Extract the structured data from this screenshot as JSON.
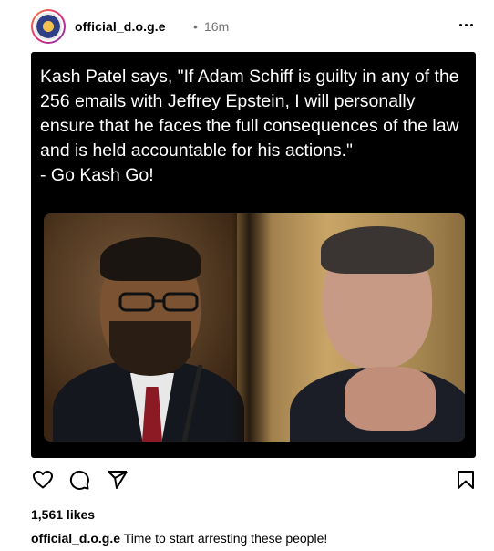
{
  "post": {
    "username": "official_d.o.g.e",
    "separator": "•",
    "time_ago": "16m",
    "media_text": "Kash Patel says, \"If Adam Schiff is guilty in any of the 256 emails with Jeffrey Epstein, I will personally ensure that he faces the full consequences of the law and is held accountable for his actions.\"\n- Go Kash Go!",
    "likes": "1,561 likes",
    "caption_user": "official_d.o.g.e",
    "caption_text": "Time to start arresting these people!"
  },
  "icons": {
    "more": "more-options-icon",
    "like": "heart-icon",
    "comment": "comment-icon",
    "share": "share-icon",
    "save": "bookmark-icon"
  },
  "colors": {
    "muted": "#737373",
    "media_bg": "#000000",
    "text": "#000000"
  }
}
